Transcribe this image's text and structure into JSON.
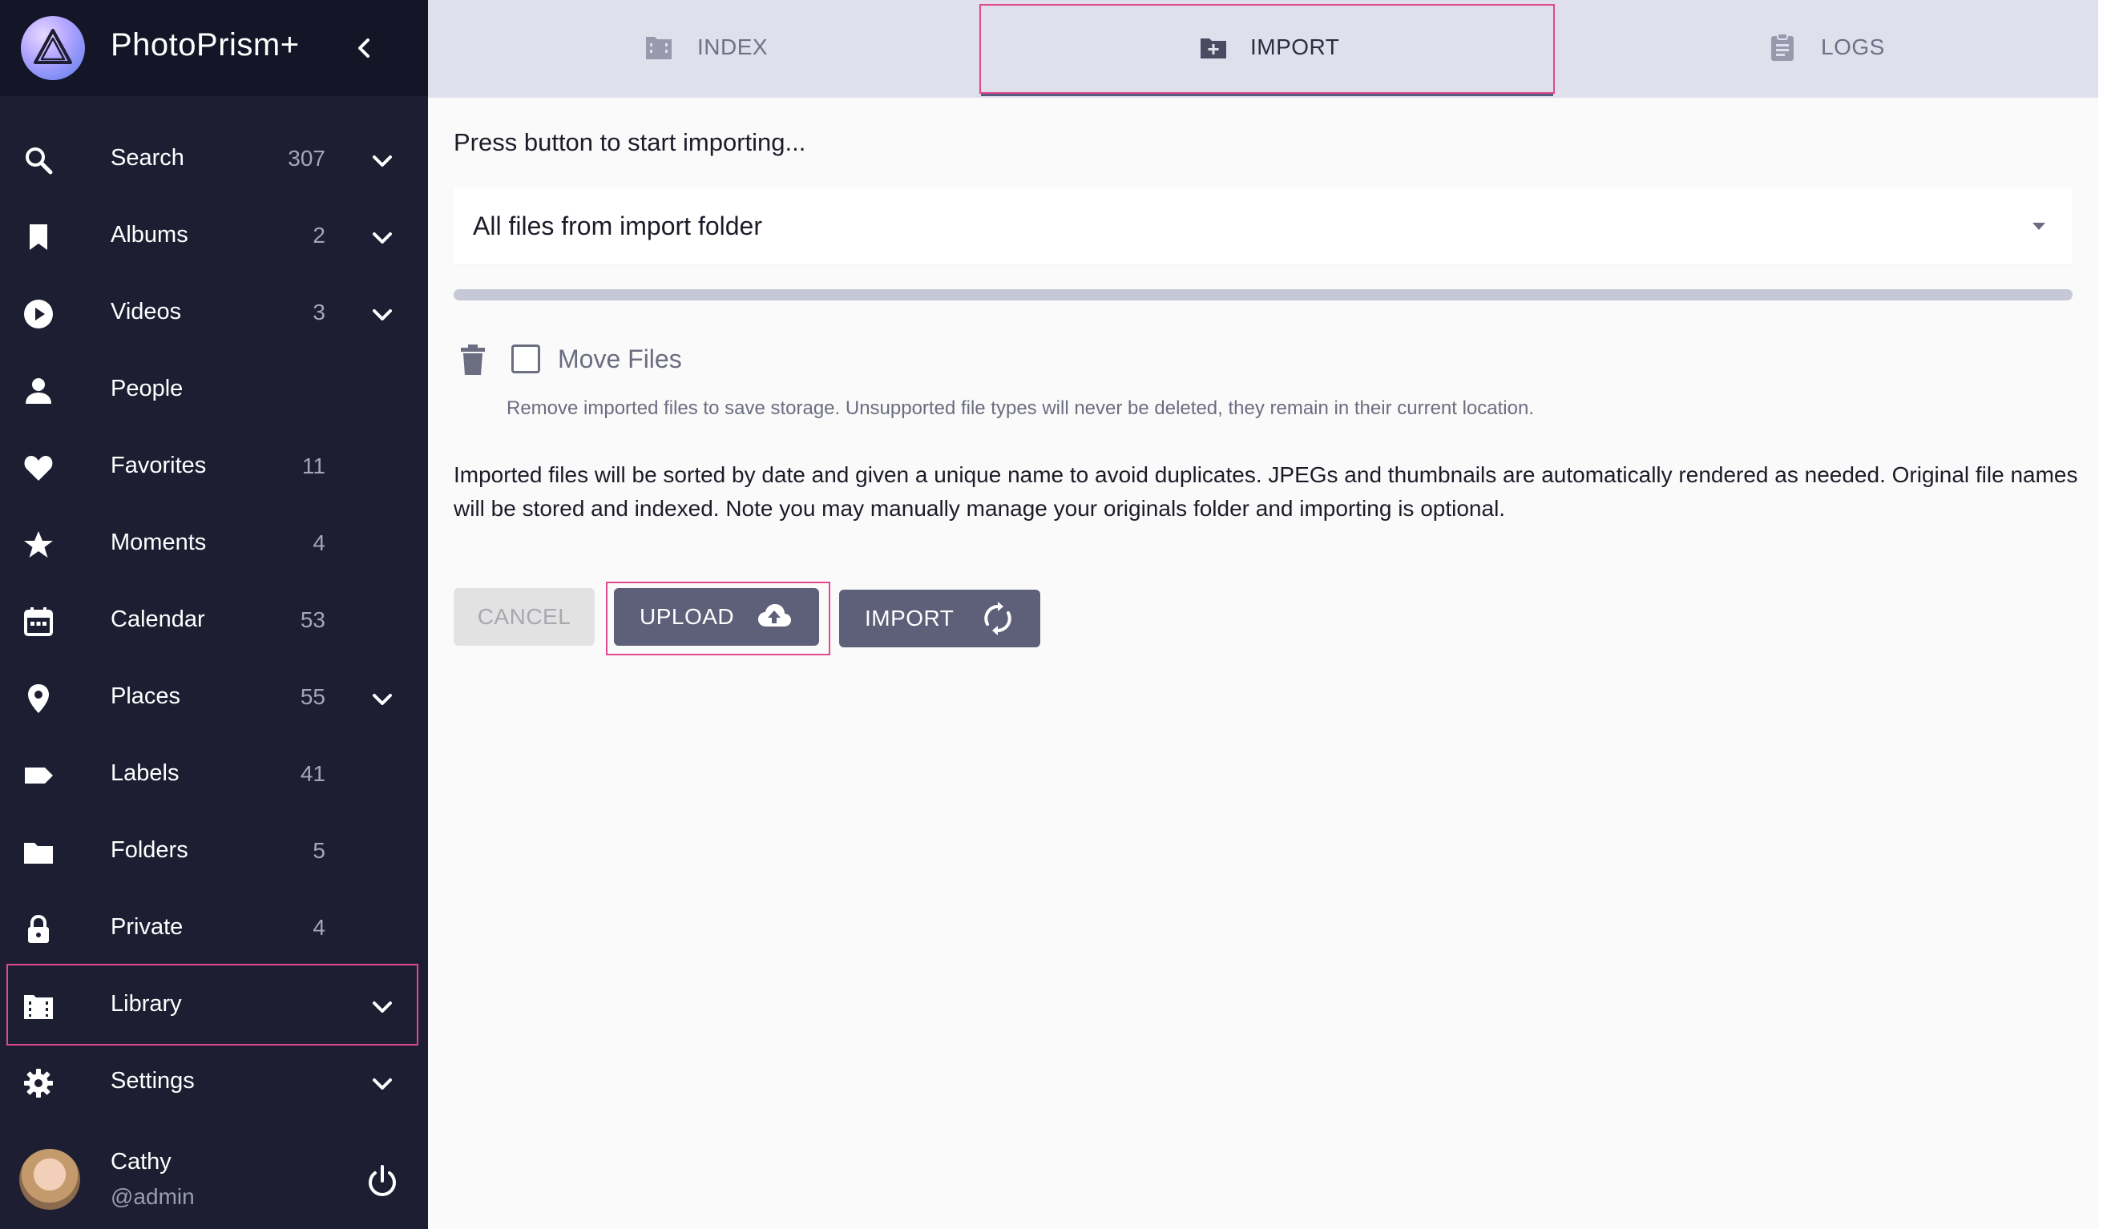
{
  "app": {
    "title": "PhotoPrism+"
  },
  "sidebar": {
    "items": [
      {
        "label": "Search",
        "count": "307",
        "icon": "search-icon"
      },
      {
        "label": "Albums",
        "count": "2",
        "icon": "bookmark-icon"
      },
      {
        "label": "Videos",
        "count": "3",
        "icon": "play-circle-icon"
      },
      {
        "label": "People",
        "count": "",
        "icon": "person-icon"
      },
      {
        "label": "Favorites",
        "count": "11",
        "icon": "heart-icon"
      },
      {
        "label": "Moments",
        "count": "4",
        "icon": "star-icon"
      },
      {
        "label": "Calendar",
        "count": "53",
        "icon": "calendar-icon"
      },
      {
        "label": "Places",
        "count": "55",
        "icon": "map-pin-icon"
      },
      {
        "label": "Labels",
        "count": "41",
        "icon": "label-icon"
      },
      {
        "label": "Folders",
        "count": "5",
        "icon": "folder-icon"
      },
      {
        "label": "Private",
        "count": "4",
        "icon": "lock-icon"
      },
      {
        "label": "Library",
        "count": "",
        "icon": "library-icon"
      },
      {
        "label": "Settings",
        "count": "",
        "icon": "gear-icon"
      }
    ],
    "user": {
      "name": "Cathy",
      "handle": "@admin"
    }
  },
  "tabs": [
    {
      "label": "INDEX",
      "icon": "film-folder-icon"
    },
    {
      "label": "IMPORT",
      "icon": "folder-plus-icon",
      "active": true
    },
    {
      "label": "LOGS",
      "icon": "clipboard-icon"
    }
  ],
  "import": {
    "status": "Press button to start importing...",
    "source_select": "All files from import folder",
    "progress_fraction": 0,
    "move_files_label": "Move Files",
    "move_files_checked": false,
    "move_files_hint": "Remove imported files to save storage. Unsupported file types will never be deleted, they remain in their current location.",
    "description": "Imported files will be sorted by date and given a unique name to avoid duplicates. JPEGs and thumbnails are automatically rendered as needed. Original file names will be stored and indexed. Note you may manually manage your originals folder and importing is optional.",
    "buttons": {
      "cancel": "CANCEL",
      "upload": "UPLOAD",
      "import": "IMPORT"
    }
  },
  "colors": {
    "sidebar_bg": "#1d1e32",
    "brand_bg": "#141526",
    "tab_bar_bg": "#dfe0ec",
    "button_bg": "#5e6079",
    "highlight": "#e0488f"
  }
}
